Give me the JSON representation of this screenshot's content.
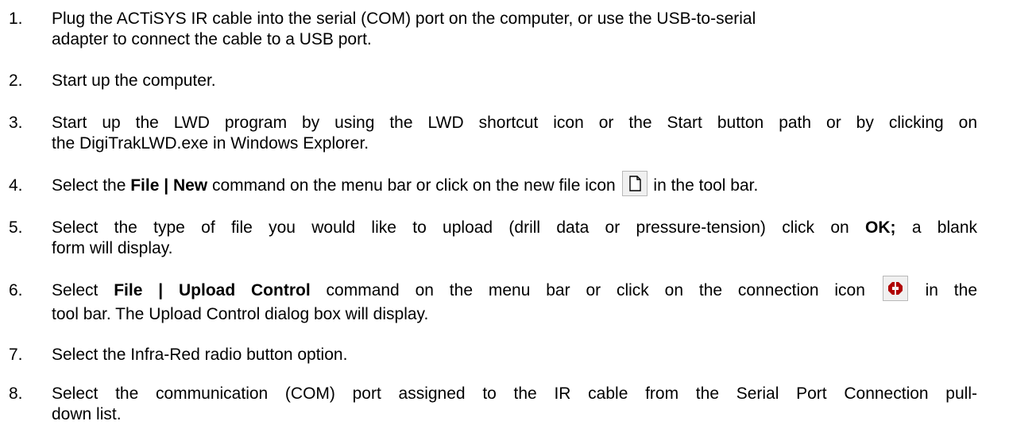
{
  "steps": [
    {
      "number": "1.",
      "line1": "Plug the ACTiSYS IR cable into the serial (COM) port on the computer, or use the USB-to-serial",
      "line2": "adapter to connect the cable to a USB port."
    },
    {
      "number": "2.",
      "text": "Start up the computer."
    },
    {
      "number": "3.",
      "line1": "Start up the LWD program by using the LWD shortcut icon or the Start button path or by clicking on",
      "line2": "the DigiTrakLWD.exe in Windows Explorer."
    },
    {
      "number": "4.",
      "before": "Select the ",
      "bold": "File | New",
      "middle": " command on the menu bar or click on the new file icon ",
      "after": " in the tool bar."
    },
    {
      "number": "5.",
      "line1_before": "Select the type of file you would like to upload (drill data or pressure-tension) click on ",
      "line1_bold": "OK;",
      "line1_after": " a blank",
      "line2": "form will display."
    },
    {
      "number": "6.",
      "before": "Select ",
      "bold": "File | Upload Control",
      "middle": " command on the menu bar or click on the connection icon ",
      "after": " in the",
      "line2": "tool bar. The Upload Control dialog box will display."
    },
    {
      "number": "7.",
      "text": "Select the Infra-Red radio button option."
    },
    {
      "number": "8.",
      "line1": "Select the communication (COM) port assigned to the IR cable from the Serial Port Connection pull-",
      "line2": "down list."
    }
  ],
  "icons": {
    "new_file": "new-file-icon",
    "connection": "connection-icon"
  }
}
